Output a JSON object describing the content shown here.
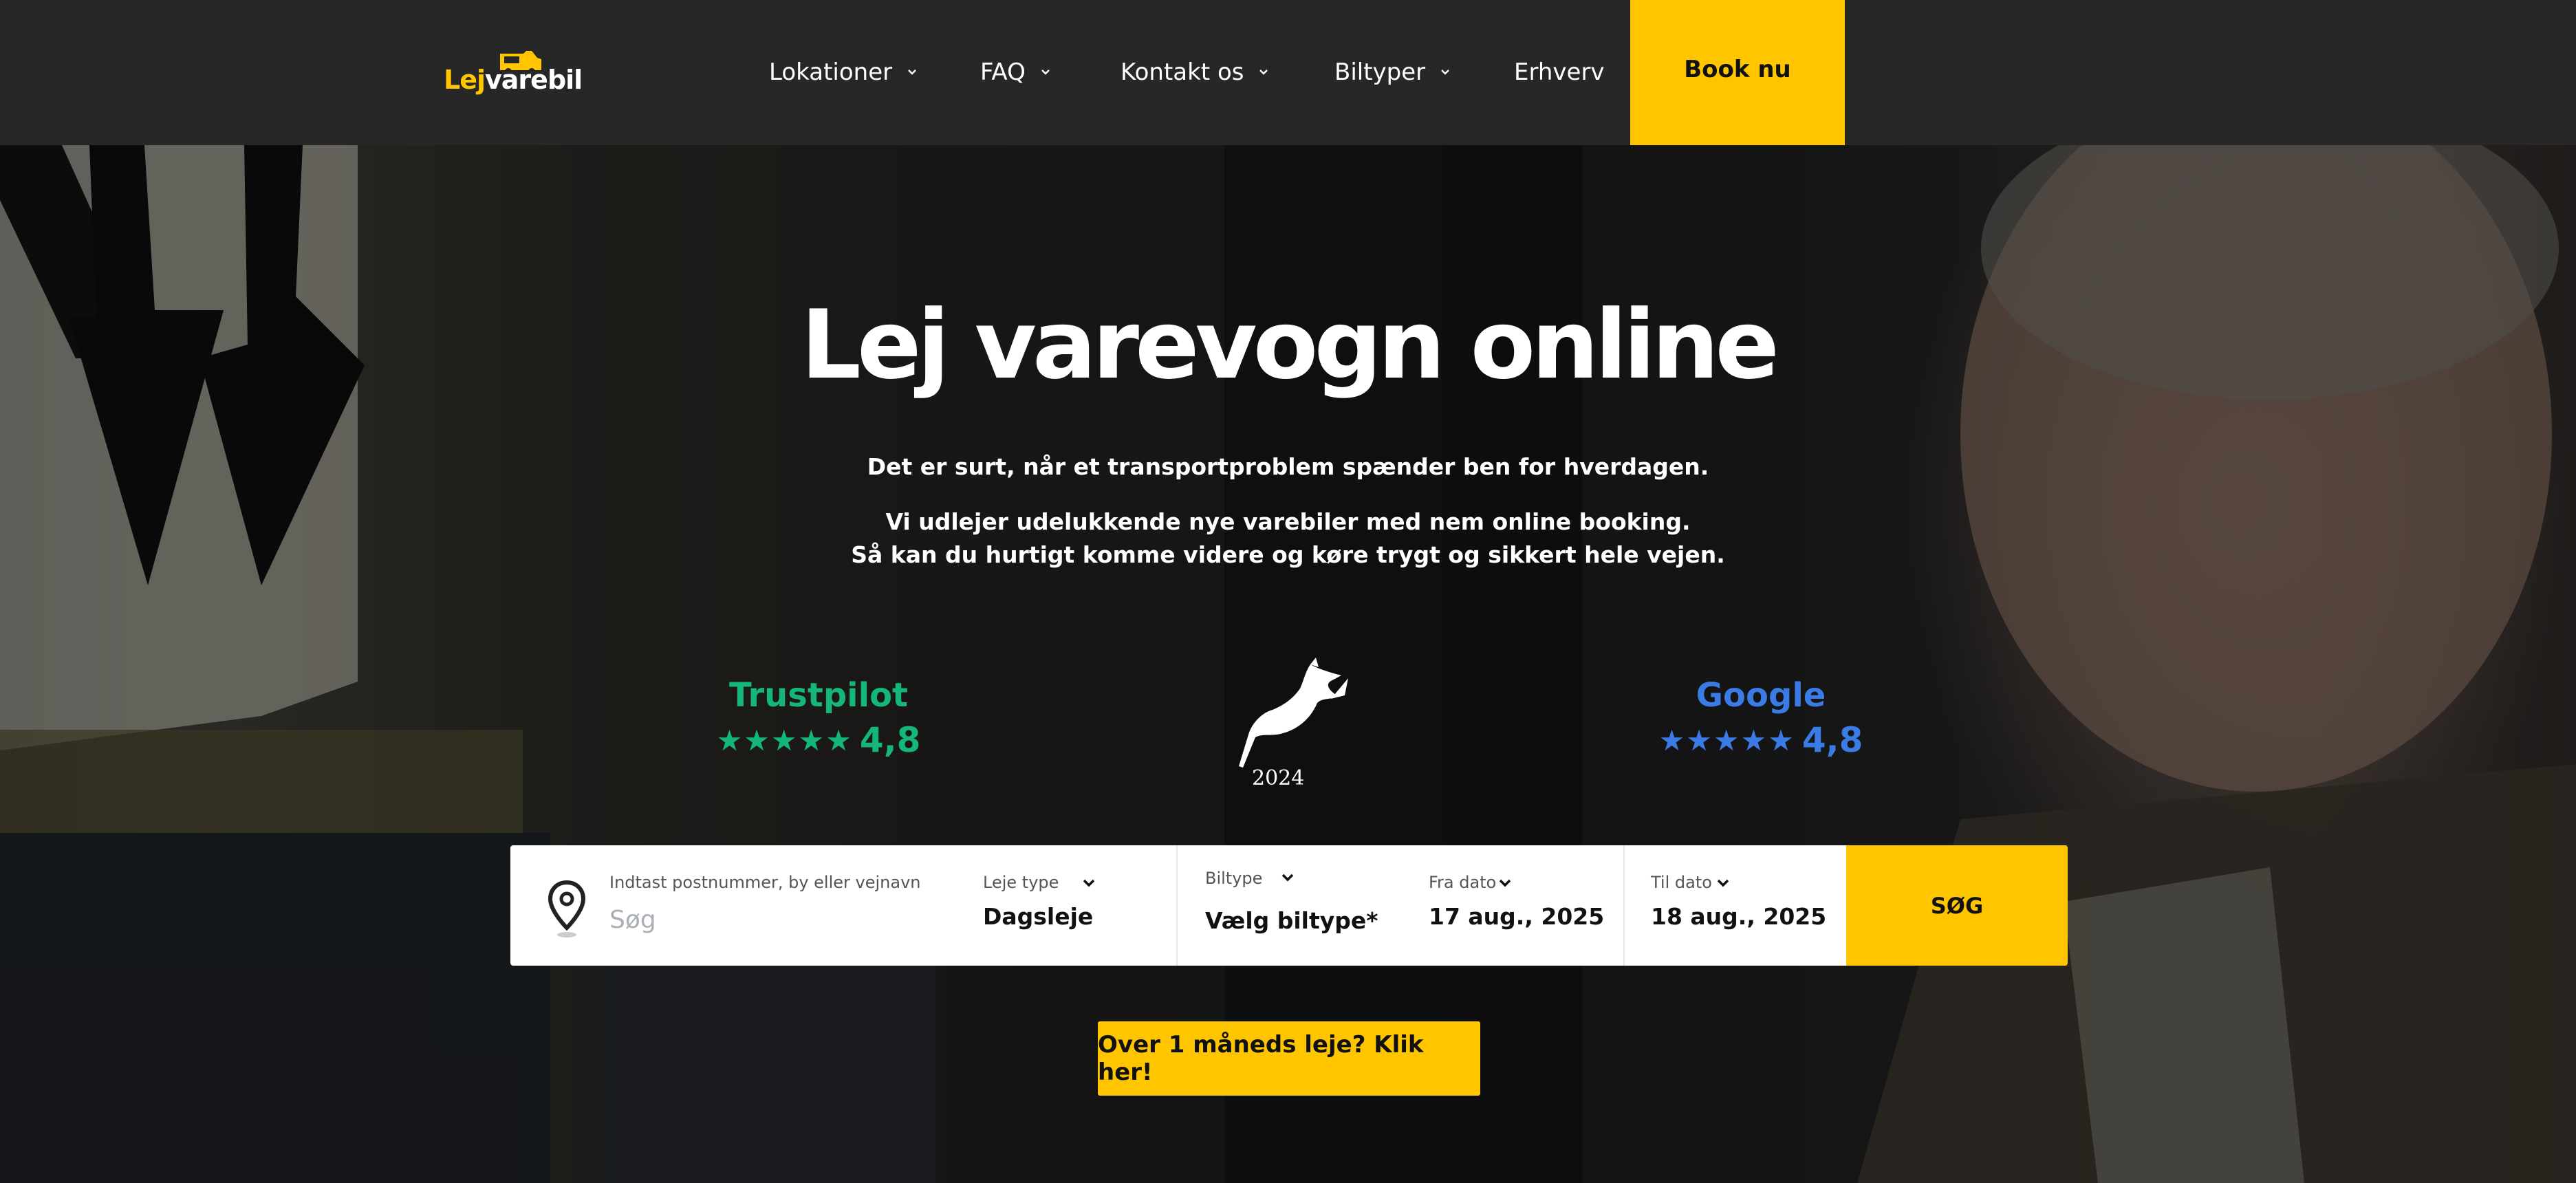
{
  "brand": {
    "logo_part1": "Lej",
    "logo_part2": "varebil",
    "accent": "#ffc600"
  },
  "nav": {
    "items": [
      {
        "label": "Lokationer",
        "has_dropdown": true
      },
      {
        "label": "FAQ",
        "has_dropdown": true
      },
      {
        "label": "Kontakt os",
        "has_dropdown": true
      },
      {
        "label": "Biltyper",
        "has_dropdown": true
      },
      {
        "label": "Erhverv",
        "has_dropdown": false
      }
    ],
    "cta": "Book nu"
  },
  "hero": {
    "title": "Lej varevogn online",
    "line1": "Det er surt, når et transportproblem spænder ben for hverdagen.",
    "line2": "Vi udlejer udelukkende nye varebiler med nem online booking.",
    "line3": "Så kan du hurtigt komme videre og køre trygt og sikkert hele vejen."
  },
  "ratings": {
    "trustpilot": {
      "name": "Trustpilot",
      "stars": "★★★★★",
      "score": "4,8",
      "color": "#14b679"
    },
    "google": {
      "name": "Google",
      "stars": "★★★★★",
      "score": "4,8",
      "color": "#3b7be6"
    },
    "award_year": "2024"
  },
  "search": {
    "location_label": "Indtast postnummer, by eller vejnavn",
    "location_placeholder": "Søg",
    "rent_type_label": "Leje type",
    "rent_type_value": "Dagsleje",
    "car_type_label": "Biltype",
    "car_type_value": "Vælg biltype*",
    "from_label": "Fra dato",
    "from_value": "17 aug., 2025",
    "to_label": "Til dato",
    "to_value": "18 aug., 2025",
    "submit": "SØG"
  },
  "month_cta": "Over 1 måneds leje? Klik her!"
}
